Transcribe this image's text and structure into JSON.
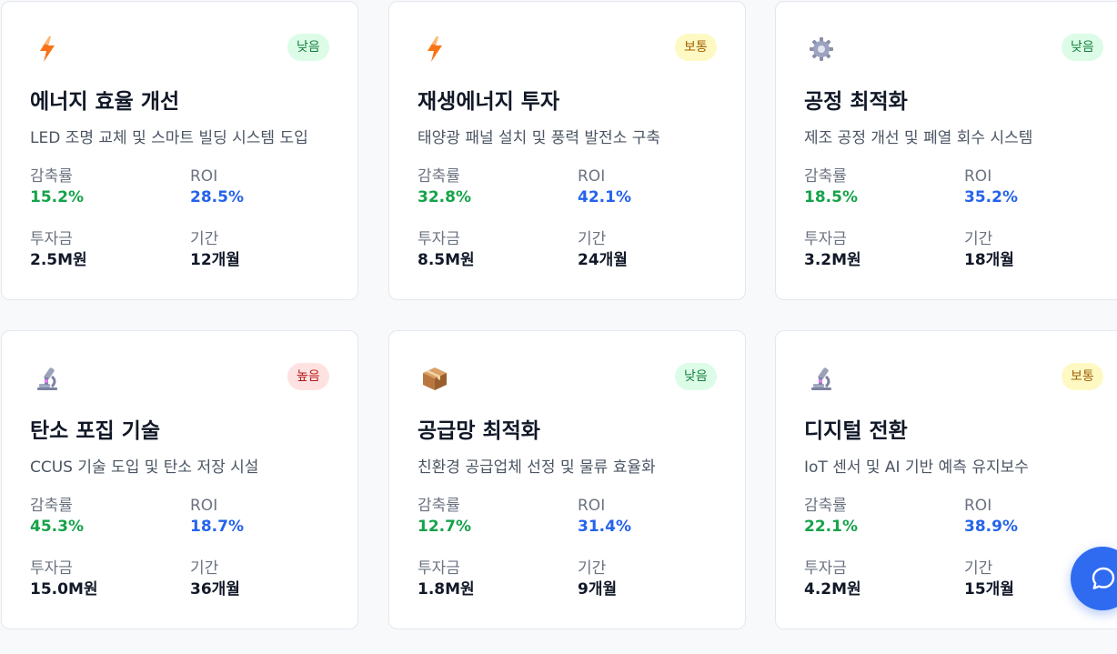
{
  "metric_labels": {
    "reduction": "감축률",
    "roi": "ROI",
    "investment": "투자금",
    "period": "기간"
  },
  "cards": [
    {
      "icon": "lightning-icon",
      "title": "에너지 효율 개선",
      "description": "LED 조명 교체 및 스마트 빌딩 시스템 도입",
      "risk": "낮음",
      "reduction": "15.2%",
      "roi": "28.5%",
      "investment": "2.5M원",
      "period": "12개월"
    },
    {
      "icon": "lightning-icon",
      "title": "재생에너지 투자",
      "description": "태양광 패널 설치 및 풍력 발전소 구축",
      "risk": "보통",
      "reduction": "32.8%",
      "roi": "42.1%",
      "investment": "8.5M원",
      "period": "24개월"
    },
    {
      "icon": "gear-icon",
      "title": "공정 최적화",
      "description": "제조 공정 개선 및 폐열 회수 시스템",
      "risk": "낮음",
      "reduction": "18.5%",
      "roi": "35.2%",
      "investment": "3.2M원",
      "period": "18개월"
    },
    {
      "icon": "microscope-icon",
      "title": "탄소 포집 기술",
      "description": "CCUS 기술 도입 및 탄소 저장 시설",
      "risk": "높음",
      "reduction": "45.3%",
      "roi": "18.7%",
      "investment": "15.0M원",
      "period": "36개월"
    },
    {
      "icon": "package-icon",
      "title": "공급망 최적화",
      "description": "친환경 공급업체 선정 및 물류 효율화",
      "risk": "낮음",
      "reduction": "12.7%",
      "roi": "31.4%",
      "investment": "1.8M원",
      "period": "9개월"
    },
    {
      "icon": "microscope-icon",
      "title": "디지털 전환",
      "description": "IoT 센서 및 AI 기반 예측 유지보수",
      "risk": "보통",
      "reduction": "22.1%",
      "roi": "38.9%",
      "investment": "4.2M원",
      "period": "15개월"
    }
  ],
  "colors": {
    "reduction": "#16a34a",
    "roi": "#2563eb",
    "badge_low_bg": "#dcfce7",
    "badge_mid_bg": "#fef9c3",
    "badge_high_bg": "#fee2e2",
    "chat_button": "#2f6bf0"
  },
  "chat_button_icon": "chat-bubble-icon"
}
